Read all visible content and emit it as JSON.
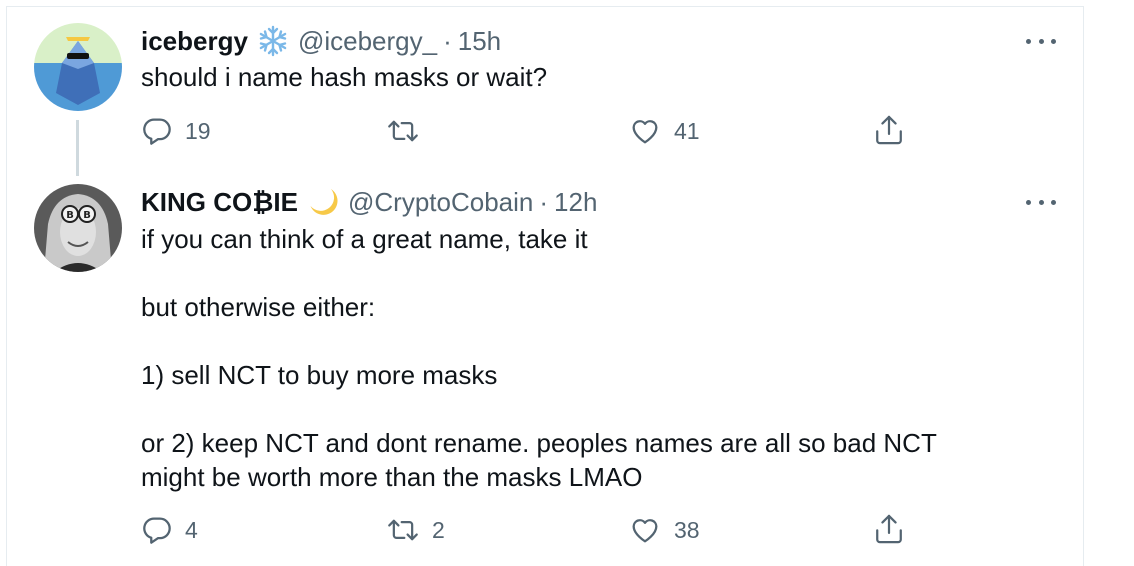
{
  "tweets": [
    {
      "display_name": "icebergy",
      "handle": "@icebergy_",
      "dot": "·",
      "time": "15h",
      "badge_icon": "snowflake-icon",
      "text": "should i name hash masks or wait?",
      "replies": "19",
      "retweets": "",
      "likes": "41"
    },
    {
      "display_name": "KING CO₿IE",
      "handle": "@CryptoCobain",
      "dot": "·",
      "time": "12h",
      "badge_icon": "crescent-moon-icon",
      "text": "if you can think of a great name, take it\n\nbut otherwise either:\n\n1) sell NCT to buy more masks\n\nor 2) keep NCT and dont rename. peoples names are all so bad NCT\nmight be worth more than the masks LMAO",
      "replies": "4",
      "retweets": "2",
      "likes": "38"
    }
  ],
  "colors": {
    "text": "#0f1419",
    "muted": "#536471",
    "thread_line": "#cfd9de",
    "snowflake": "#7bb8e8",
    "moon": "#f7c948"
  }
}
